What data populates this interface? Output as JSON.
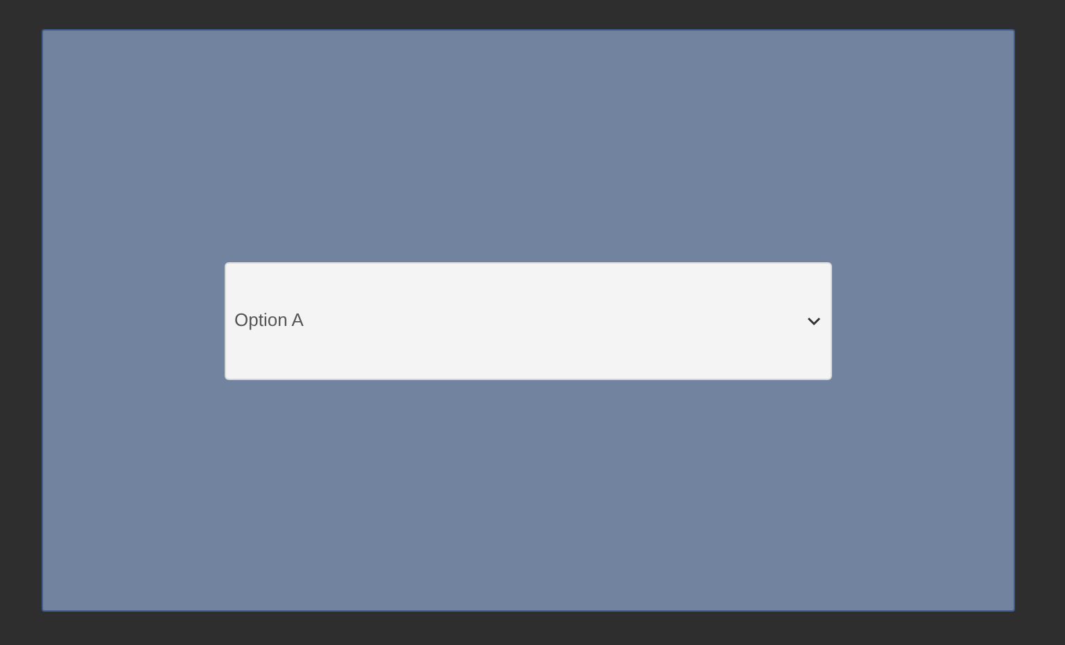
{
  "dropdown": {
    "value": "Option A"
  }
}
